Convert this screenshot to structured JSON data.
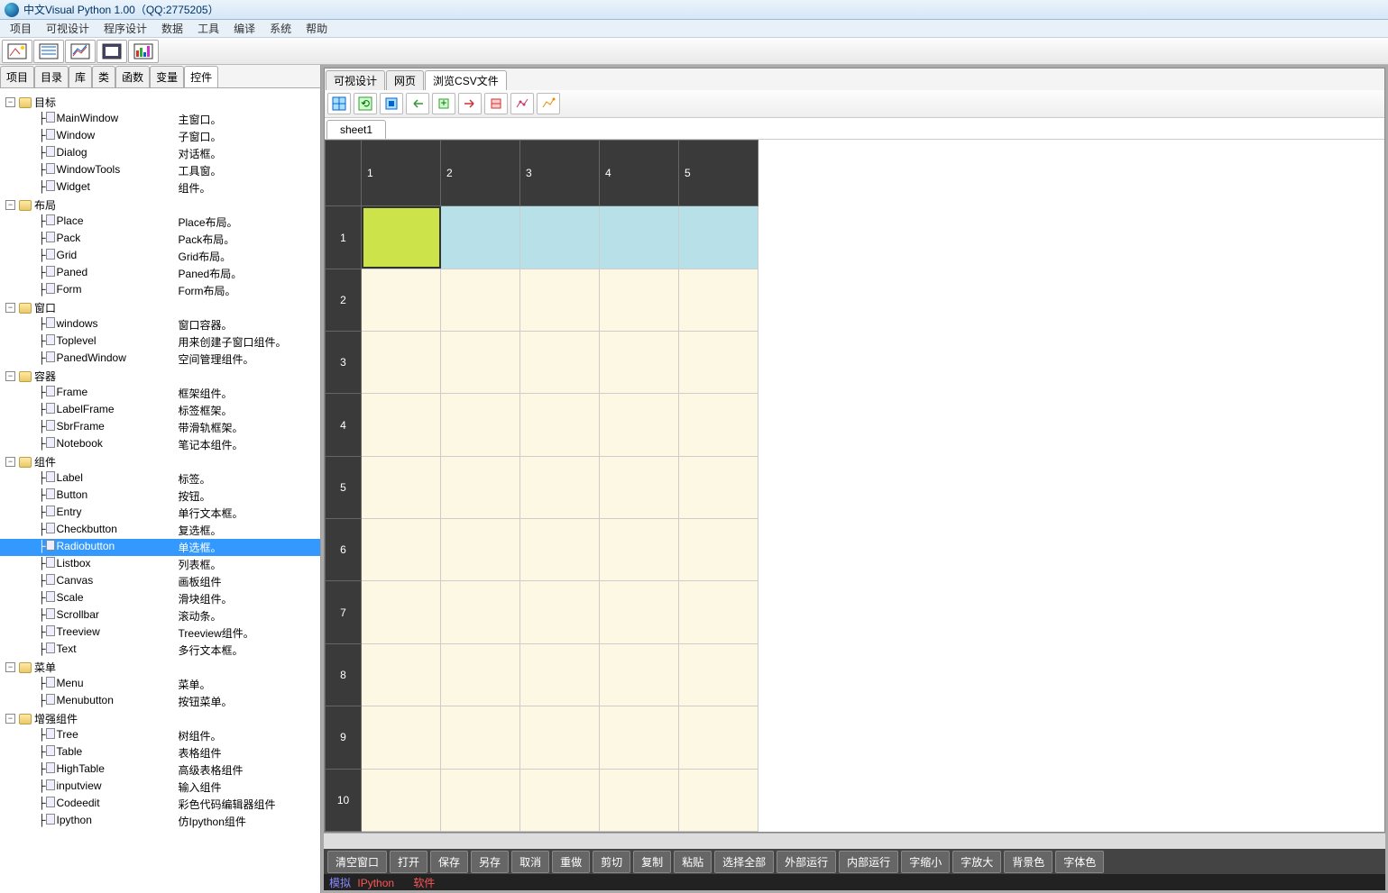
{
  "title": "中文Visual Python 1.00（QQ:2775205）",
  "menubar": [
    "项目",
    "可视设计",
    "程序设计",
    "数据",
    "工具",
    "编译",
    "系统",
    "帮助"
  ],
  "left_tabs": [
    "项目",
    "目录",
    "库",
    "类",
    "函数",
    "变量",
    "控件"
  ],
  "left_active_tab": 6,
  "tree": [
    {
      "group": "目标",
      "items": [
        {
          "name": "MainWindow",
          "desc": "主窗口。"
        },
        {
          "name": "Window",
          "desc": "子窗口。"
        },
        {
          "name": "Dialog",
          "desc": "对话框。"
        },
        {
          "name": "WindowTools",
          "desc": "工具窗。"
        },
        {
          "name": "Widget",
          "desc": "组件。"
        }
      ]
    },
    {
      "group": "布局",
      "items": [
        {
          "name": "Place",
          "desc": "Place布局。"
        },
        {
          "name": "Pack",
          "desc": "Pack布局。"
        },
        {
          "name": "Grid",
          "desc": "Grid布局。"
        },
        {
          "name": "Paned",
          "desc": "Paned布局。"
        },
        {
          "name": "Form",
          "desc": "Form布局。"
        }
      ]
    },
    {
      "group": "窗口",
      "items": [
        {
          "name": "windows",
          "desc": "窗口容器。"
        },
        {
          "name": "Toplevel",
          "desc": "用来创建子窗口组件。"
        },
        {
          "name": "PanedWindow",
          "desc": "空间管理组件。"
        }
      ]
    },
    {
      "group": "容器",
      "items": [
        {
          "name": "Frame",
          "desc": "框架组件。"
        },
        {
          "name": "LabelFrame",
          "desc": "标签框架。"
        },
        {
          "name": "SbrFrame",
          "desc": "带滑轨框架。"
        },
        {
          "name": "Notebook",
          "desc": "笔记本组件。"
        }
      ]
    },
    {
      "group": "组件",
      "items": [
        {
          "name": "Label",
          "desc": "标签。"
        },
        {
          "name": "Button",
          "desc": "按钮。"
        },
        {
          "name": "Entry",
          "desc": "单行文本框。"
        },
        {
          "name": "Checkbutton",
          "desc": "复选框。"
        },
        {
          "name": "Radiobutton",
          "desc": "单选框。",
          "selected": true
        },
        {
          "name": "Listbox",
          "desc": "列表框。"
        },
        {
          "name": "Canvas",
          "desc": "画板组件"
        },
        {
          "name": "Scale",
          "desc": "滑块组件。"
        },
        {
          "name": "Scrollbar",
          "desc": "滚动条。"
        },
        {
          "name": "Treeview",
          "desc": "Treeview组件。"
        },
        {
          "name": "Text",
          "desc": "多行文本框。"
        }
      ]
    },
    {
      "group": "菜单",
      "items": [
        {
          "name": "Menu",
          "desc": "菜单。"
        },
        {
          "name": "Menubutton",
          "desc": "按钮菜单。"
        }
      ]
    },
    {
      "group": "增强组件",
      "items": [
        {
          "name": "Tree",
          "desc": "树组件。"
        },
        {
          "name": "Table",
          "desc": "表格组件"
        },
        {
          "name": "HighTable",
          "desc": "高级表格组件"
        },
        {
          "name": "inputview",
          "desc": "输入组件"
        },
        {
          "name": "Codeedit",
          "desc": "彩色代码编辑器组件"
        },
        {
          "name": "Ipython",
          "desc": "仿Ipython组件"
        }
      ]
    }
  ],
  "right_tabs": [
    "可视设计",
    "网页",
    "浏览CSV文件"
  ],
  "right_active_tab": 2,
  "sheet_name": "sheet1",
  "grid": {
    "cols": [
      "1",
      "2",
      "3",
      "4",
      "5"
    ],
    "rows": [
      "1",
      "2",
      "3",
      "4",
      "5",
      "6",
      "7",
      "8",
      "9",
      "10"
    ]
  },
  "bottom_buttons": [
    "清空窗口",
    "打开",
    "保存",
    "另存",
    "取消",
    "重做",
    "剪切",
    "复制",
    "粘贴",
    "选择全部",
    "外部运行",
    "内部运行",
    "字缩小",
    "字放大",
    "背景色",
    "字体色"
  ],
  "status": {
    "a": "模拟",
    "b": "IPython",
    "c": "软件"
  }
}
